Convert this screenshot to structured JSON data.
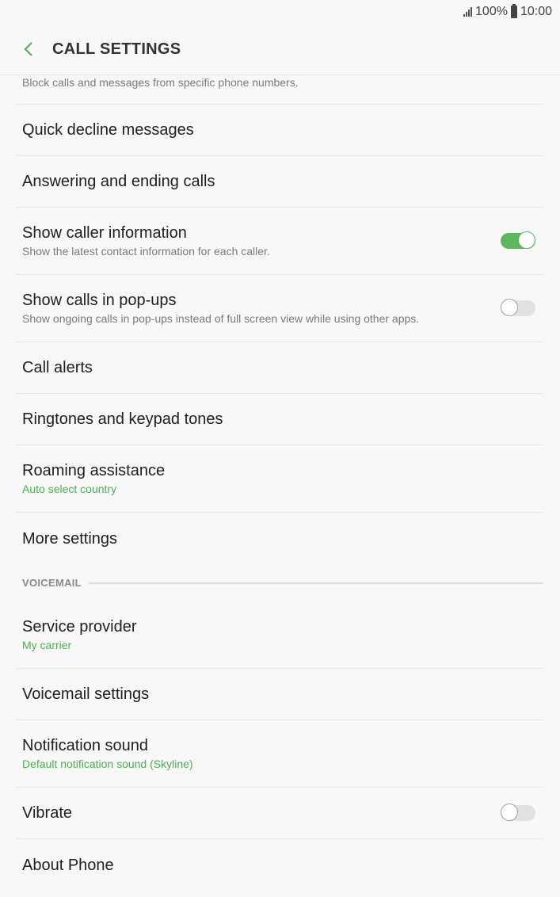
{
  "status_bar": {
    "battery": "100%",
    "time": "10:00"
  },
  "header": {
    "title": "CALL SETTINGS",
    "back_icon": "chevron-left-icon",
    "accent_color": "#4caf50"
  },
  "partial_item": {
    "subtitle": "Block calls and messages from specific phone numbers."
  },
  "items": [
    {
      "title": "Quick decline messages"
    },
    {
      "title": "Answering and ending calls"
    },
    {
      "title": "Show caller information",
      "subtitle": "Show the latest contact information for each caller.",
      "toggle": true
    },
    {
      "title": "Show calls in pop-ups",
      "subtitle": "Show ongoing calls in pop-ups instead of full screen view while using other apps.",
      "toggle": false
    },
    {
      "title": "Call alerts"
    },
    {
      "title": "Ringtones and keypad tones"
    },
    {
      "title": "Roaming assistance",
      "subtitle": "Auto select country"
    },
    {
      "title": "More settings"
    }
  ],
  "voicemail_section": {
    "label": "VOICEMAIL",
    "items": [
      {
        "title": "Service provider",
        "subtitle": "My carrier"
      },
      {
        "title": "Voicemail settings"
      },
      {
        "title": "Notification sound",
        "subtitle": "Default notification sound (Skyline)"
      },
      {
        "title": "Vibrate",
        "toggle": false
      },
      {
        "title": "About Phone"
      }
    ]
  }
}
